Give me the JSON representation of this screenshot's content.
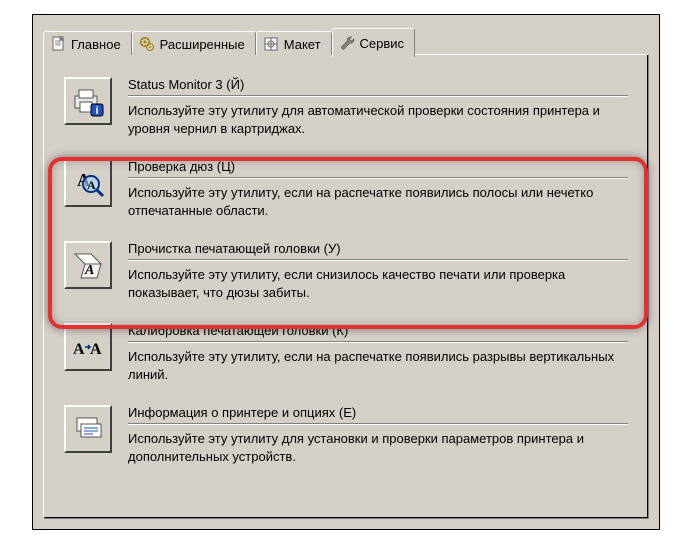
{
  "tabs": {
    "main": "Главное",
    "advanced": "Расширенные",
    "layout": "Макет",
    "service": "Сервис"
  },
  "utilities": {
    "status": {
      "title": "Status Monitor 3 (Й)",
      "desc": "Используйте эту утилиту для автоматической проверки состояния принтера и уровня чернил в картриджах."
    },
    "nozzle": {
      "title": "Проверка дюз (Ц)",
      "desc": "Используйте эту утилиту, если на распечатке появились полосы или нечетко отпечатанные области."
    },
    "clean": {
      "title": "Прочистка печатающей головки (У)",
      "desc": "Используйте эту утилиту, если снизилось качество печати или проверка показывает, что дюзы забиты."
    },
    "align": {
      "title": "Калибровка печатающей головки (К)",
      "desc": "Используйте эту утилиту, если на распечатке появились разрывы вертикальных линий."
    },
    "info": {
      "title": "Информация о принтере и опциях (Е)",
      "desc": "Используйте эту утилиту для установки и проверки параметров принтера и дополнительных устройств."
    }
  }
}
